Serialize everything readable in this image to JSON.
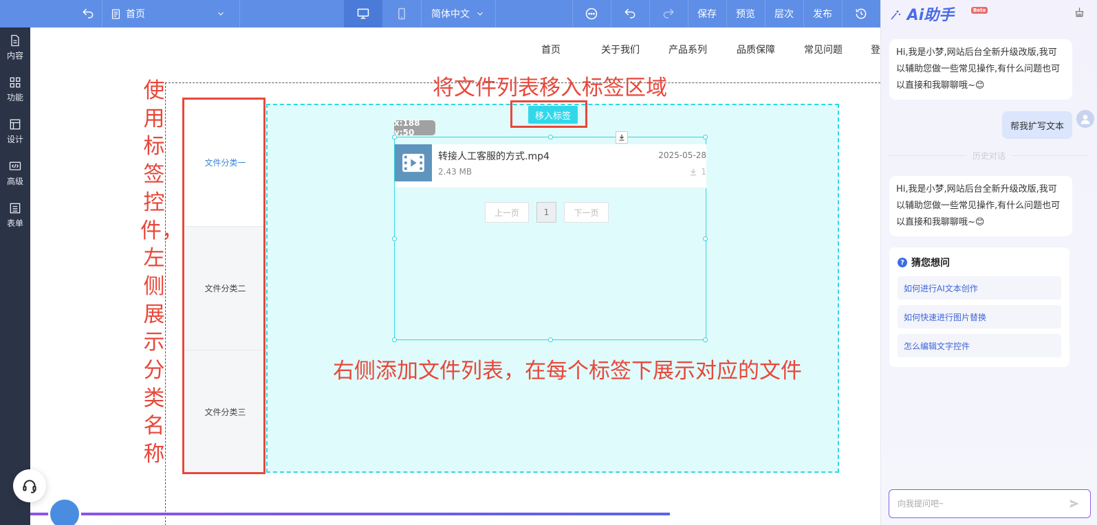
{
  "toolbar": {
    "page_select": "首页",
    "language": "简体中文",
    "save": "保存",
    "preview": "预览",
    "layers": "层次",
    "publish": "发布"
  },
  "sidebar": {
    "items": [
      {
        "label": "内容",
        "icon": "document-icon"
      },
      {
        "label": "功能",
        "icon": "grid-icon"
      },
      {
        "label": "设计",
        "icon": "layout-icon"
      },
      {
        "label": "高级",
        "icon": "code-icon"
      },
      {
        "label": "表单",
        "icon": "form-icon"
      }
    ]
  },
  "site_nav": [
    "首页",
    "关于我们",
    "产品系列",
    "品质保障",
    "常见问题",
    "登"
  ],
  "annotations": {
    "top": "将文件列表移入标签区域",
    "right": "右侧添加文件列表，在每个标签下展示对应的文件",
    "left": "使用标签控件，左侧展示分类名称"
  },
  "tabs": [
    "文件分类一",
    "文件分类二",
    "文件分类三"
  ],
  "move_button": "移入标签",
  "coords": "x:188 y:50",
  "file": {
    "name": "转接人工客服的方式.mp4",
    "size": "2.43 MB",
    "date": "2025-05-28",
    "downloads": "1"
  },
  "pager": {
    "prev": "上一页",
    "current": "1",
    "next": "下一页"
  },
  "ai": {
    "title": "Ai助手",
    "beta": "Beta",
    "greeting_1": "Hi,我是小梦,网站后台全新升级改版,我可以辅助您做一些常见操作,有什么问题也可以直接和我聊聊哦~😊",
    "user_message": "帮我扩写文本",
    "history_label": "历史对话",
    "greeting_2": "Hi,我是小梦,网站后台全新升级改版,我可以辅助您做一些常见操作,有什么问题也可以直接和我聊聊哦~😊",
    "suggest_title": "猜您想问",
    "suggestions": [
      "如何进行AI文本创作",
      "如何快速进行图片替换",
      "怎么编辑文字控件"
    ],
    "input_placeholder": "向我提问吧~"
  },
  "colors": {
    "toolbar": "#5e8ee6",
    "sidebar": "#2b3347",
    "annotation_red": "#e8473a",
    "tab_active": "#3d86d6",
    "selection_cyan": "#33d6e0",
    "ai_accent": "#4a6ce8"
  }
}
